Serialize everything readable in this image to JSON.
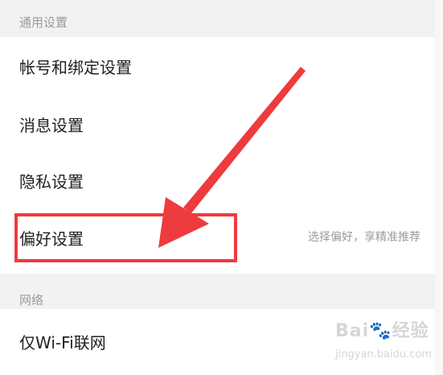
{
  "sections": [
    {
      "title": "通用设置",
      "items": [
        {
          "label": "帐号和绑定设置",
          "desc": ""
        },
        {
          "label": "消息设置",
          "desc": ""
        },
        {
          "label": "隐私设置",
          "desc": ""
        },
        {
          "label": "偏好设置",
          "desc": "选择偏好，享精准推荐"
        }
      ]
    },
    {
      "title": "网络",
      "items": [
        {
          "label": "仅Wi-Fi联网",
          "desc": ""
        }
      ]
    }
  ],
  "watermark": {
    "brand": "Bai",
    "suffix": "经验",
    "domain": "jingyan.baidu.com"
  },
  "colors": {
    "annotation": "#ee3b3e",
    "background": "#f2f2f2",
    "text": "#222222",
    "muted": "#9b9b9b"
  }
}
